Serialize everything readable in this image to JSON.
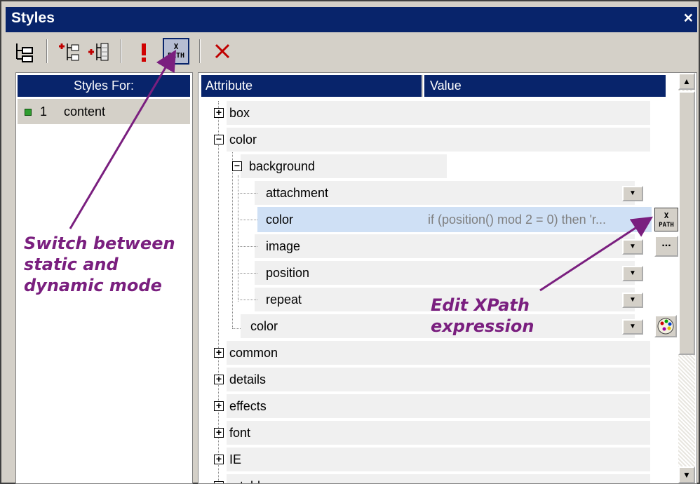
{
  "window": {
    "title": "Styles",
    "close": "×"
  },
  "toolbar": {
    "buttons": [
      "tree-toggle-icon",
      "add-before-icon",
      "add-after-icon",
      "important-icon",
      "xpath-icon",
      "delete-icon"
    ]
  },
  "left_panel": {
    "header": "Styles For:",
    "rows": [
      {
        "number": "1",
        "label": "content"
      }
    ]
  },
  "grid": {
    "attribute_header": "Attribute",
    "value_header": "Value",
    "rows": [
      {
        "label": "box"
      },
      {
        "label": "color"
      },
      {
        "label": "background"
      },
      {
        "label": "attachment"
      },
      {
        "label": "color",
        "value": "if (position() mod 2 = 0) then 'r..."
      },
      {
        "label": "image"
      },
      {
        "label": "position"
      },
      {
        "label": "repeat"
      },
      {
        "label": "color"
      },
      {
        "label": "common"
      },
      {
        "label": "details"
      },
      {
        "label": "effects"
      },
      {
        "label": "font"
      },
      {
        "label": "IE"
      },
      {
        "label": "...tables"
      }
    ]
  },
  "xpath_button_label": "X\nPATH",
  "ellipsis_label": "...",
  "annotations": {
    "mode_note": "Switch between\nstatic and\ndynamic mode",
    "xpath_note": "Edit XPath\nexpression"
  },
  "colors": {
    "title_bar": "#08246b",
    "selected_row": "#cfe0f5",
    "annotation": "#7a1f7f",
    "chrome": "#d4d0c8"
  }
}
